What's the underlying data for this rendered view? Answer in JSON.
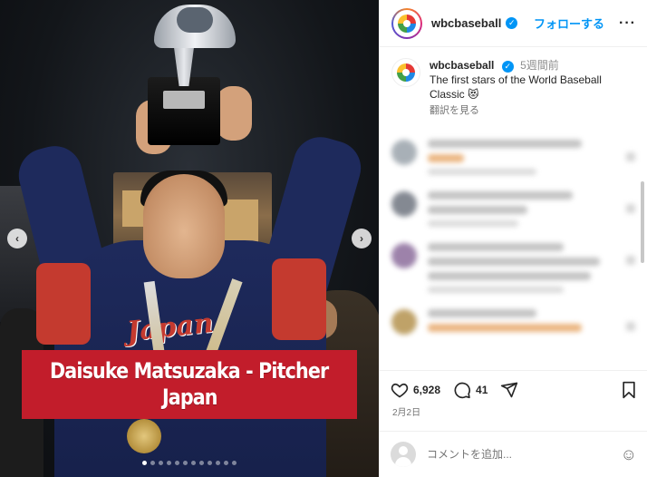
{
  "media": {
    "caption_line1": "Daisuke Matsuzaka - Pitcher",
    "caption_line2": "Japan",
    "jersey_text": "Japan",
    "carousel_total": 12,
    "carousel_active": 0
  },
  "header": {
    "username": "wbcbaseball",
    "follow_label": "フォローする",
    "more_label": "···"
  },
  "caption": {
    "username": "wbcbaseball",
    "time_ago": "5週間前",
    "text": "The first stars of the World Baseball Classic 😻",
    "translate_label": "翻訳を見る"
  },
  "actions": {
    "likes": "6,928",
    "comments": "41",
    "date": "2月2日"
  },
  "comment_input": {
    "placeholder": "コメントを追加..."
  },
  "colors": {
    "accent": "#0095f6",
    "caption_banner": "#c21d2b"
  }
}
